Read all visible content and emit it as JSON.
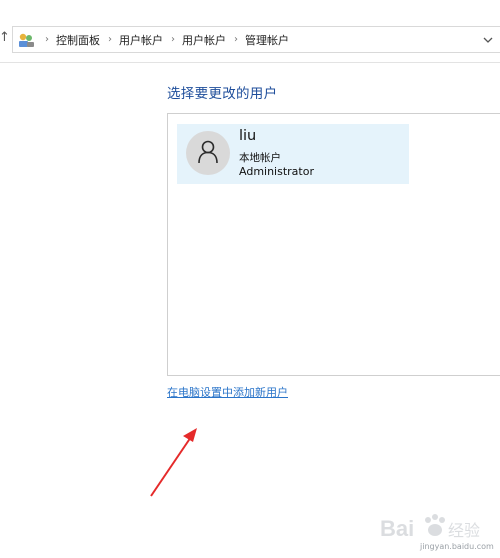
{
  "breadcrumb": {
    "items": [
      "控制面板",
      "用户帐户",
      "用户帐户",
      "管理帐户"
    ],
    "separator": "›"
  },
  "page": {
    "title": "选择要更改的用户",
    "add_user_link": "在电脑设置中添加新用户"
  },
  "users": [
    {
      "name": "liu",
      "type": "本地帐户",
      "role": "Administrator"
    }
  ],
  "watermark": {
    "text": "Bai 经验",
    "url": "jingyan.baidu.com"
  },
  "colors": {
    "title": "#1f4e9b",
    "link": "#2a74c9",
    "tile_selected": "#e5f3fb",
    "arrow": "#e52a2a"
  }
}
